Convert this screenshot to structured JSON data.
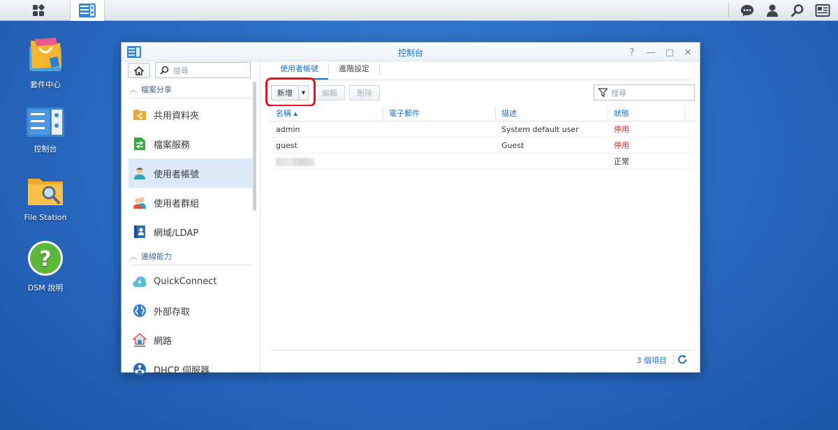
{
  "taskbar": {
    "main_menu_icon": "grid-menu-icon",
    "active_app_icon": "control-panel-icon",
    "right_icons": [
      "chat-icon",
      "user-icon",
      "search-icon",
      "widgets-icon"
    ]
  },
  "desktop": {
    "icons": [
      {
        "label": "套件中心",
        "icon": "package-center-icon"
      },
      {
        "label": "控制台",
        "icon": "control-panel-icon"
      },
      {
        "label": "File Station",
        "icon": "folder-search-icon"
      },
      {
        "label": "DSM 說明",
        "icon": "help-icon"
      }
    ]
  },
  "window": {
    "title": "控制台",
    "controls": [
      "?",
      "—",
      "□",
      "✕"
    ],
    "sidebar": {
      "search_placeholder": "搜尋",
      "groups": [
        {
          "label": "檔案分享",
          "items": [
            {
              "label": "共用資料夾",
              "icon": "shared-folder-icon"
            },
            {
              "label": "檔案服務",
              "icon": "file-services-icon"
            },
            {
              "label": "使用者帳號",
              "icon": "user-account-icon",
              "active": true
            },
            {
              "label": "使用者群組",
              "icon": "user-group-icon"
            },
            {
              "label": "網域/LDAP",
              "icon": "domain-ldap-icon"
            }
          ]
        },
        {
          "label": "連線能力",
          "items": [
            {
              "label": "QuickConnect",
              "icon": "quickconnect-icon"
            },
            {
              "label": "外部存取",
              "icon": "external-access-icon"
            },
            {
              "label": "網路",
              "icon": "network-icon"
            },
            {
              "label": "DHCP 伺服器",
              "icon": "dhcp-server-icon"
            }
          ]
        }
      ]
    },
    "tabs": [
      {
        "label": "使用者帳號",
        "active": true
      },
      {
        "label": "進階設定",
        "active": false
      }
    ],
    "toolbar": {
      "create_label": "新增",
      "edit_label": "編輯",
      "delete_label": "刪除",
      "filter_placeholder": "搜尋"
    },
    "table": {
      "columns": [
        "名稱 ▴",
        "電子郵件",
        "描述",
        "狀態"
      ],
      "rows": [
        {
          "name": "admin",
          "email": "",
          "description": "System default user",
          "status": "停用",
          "status_color": "#e02424"
        },
        {
          "name": "guest",
          "email": "",
          "description": "Guest",
          "status": "停用",
          "status_color": "#e02424"
        },
        {
          "name": "",
          "email": "",
          "description": "",
          "status": "正常",
          "status_color": "#333333",
          "name_obscured": true
        }
      ]
    },
    "footer": {
      "count_label": "3 個項目"
    }
  },
  "colors": {
    "accent": "#1f6fc5",
    "highlight_box": "#e3141c",
    "disabled_status": "#e02424"
  }
}
